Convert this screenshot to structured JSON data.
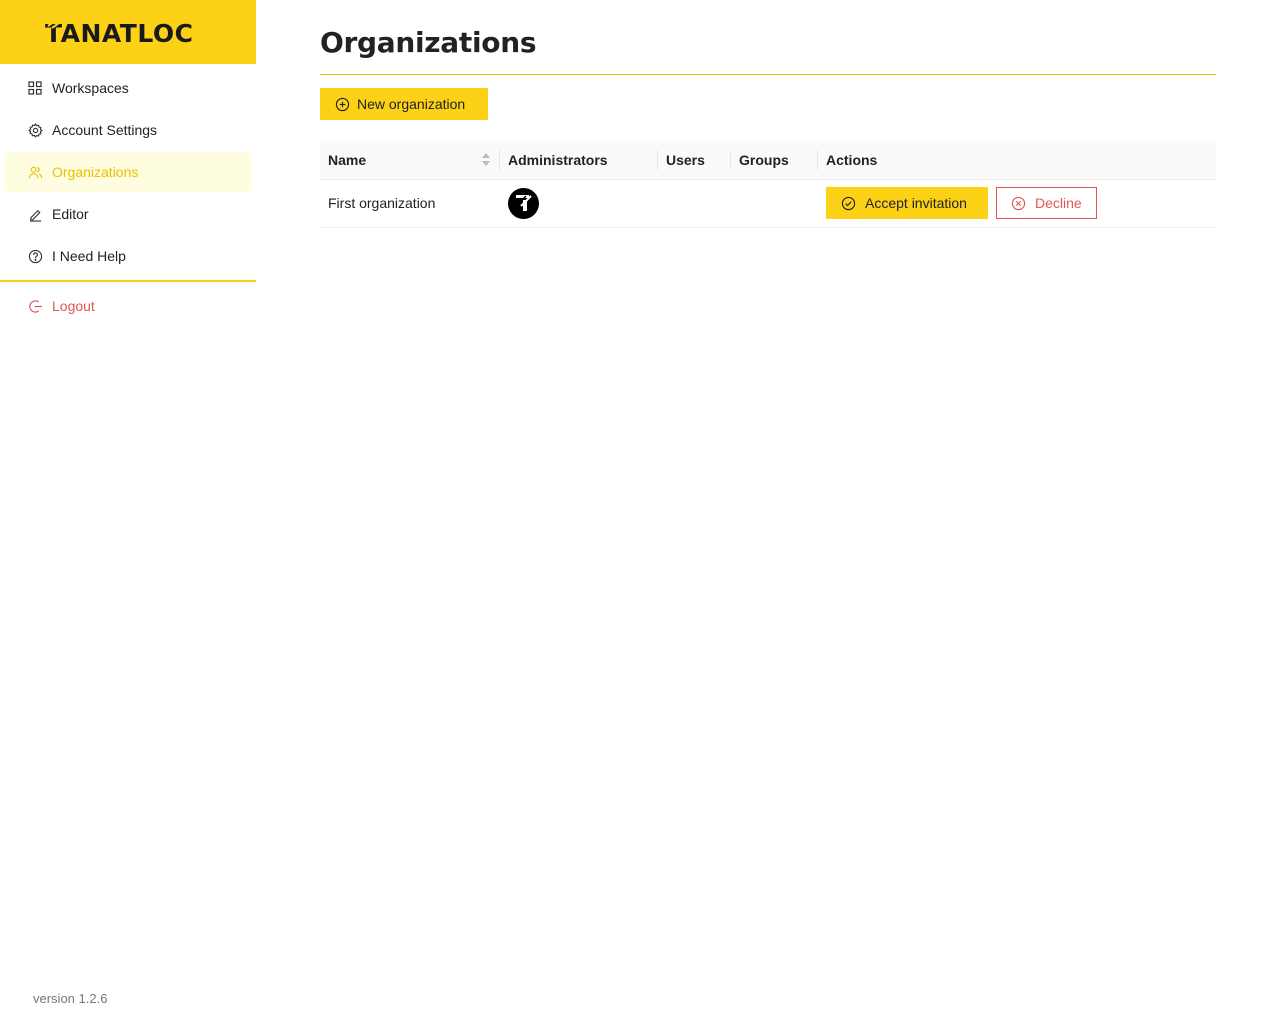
{
  "brand": {
    "name": "TANATLOC",
    "accent": "#fcd116",
    "danger": "#e05656"
  },
  "sidebar": {
    "items": [
      {
        "label": "Workspaces",
        "icon": "grid-icon",
        "active": false
      },
      {
        "label": "Account Settings",
        "icon": "gear-icon",
        "active": false
      },
      {
        "label": "Organizations",
        "icon": "users-icon",
        "active": true
      },
      {
        "label": "Editor",
        "icon": "pencil-icon",
        "active": false
      },
      {
        "label": "I Need Help",
        "icon": "question-circle-icon",
        "active": false
      }
    ],
    "logout": {
      "label": "Logout",
      "icon": "logout-icon"
    },
    "version": "version 1.2.6"
  },
  "main": {
    "title": "Organizations",
    "new_button": "New organization",
    "table": {
      "columns": [
        "Name",
        "Administrators",
        "Users",
        "Groups",
        "Actions"
      ],
      "rows": [
        {
          "name": "First organization",
          "administrators": [
            "avatar"
          ],
          "users": "",
          "groups": "",
          "accept_label": "Accept invitation",
          "decline_label": "Decline"
        }
      ]
    }
  }
}
